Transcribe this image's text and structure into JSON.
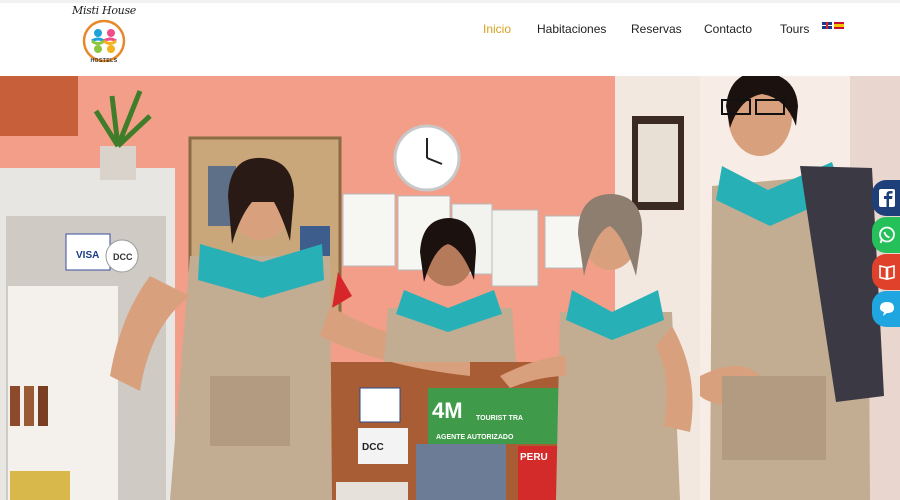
{
  "brand": {
    "name": "Misti House",
    "subtitle": "HOSTELS"
  },
  "nav": {
    "items": [
      {
        "label": "Inicio",
        "active": true
      },
      {
        "label": "Habitaciones",
        "active": false
      },
      {
        "label": "Reservas",
        "active": false
      },
      {
        "label": "Contacto",
        "active": false
      },
      {
        "label": "Tours",
        "active": false
      }
    ],
    "active_color": "#d6a21e",
    "languages": [
      "en-flag-icon",
      "es-flag-icon"
    ]
  },
  "hero": {
    "sign_main": "4M",
    "sign_sub": "TOURIST TRA",
    "sign_agent": "AGENTE AUTORIZADO",
    "visa_card": "VISA",
    "dcc_card": "DCC",
    "dcc_card_2": "DCC",
    "peru_label": "PERU"
  },
  "social": {
    "items": [
      "facebook-icon",
      "whatsapp-icon",
      "book-icon",
      "chat-icon"
    ],
    "colors": [
      "#1d3f7a",
      "#25c05a",
      "#e0412b",
      "#1fa6e0"
    ]
  }
}
